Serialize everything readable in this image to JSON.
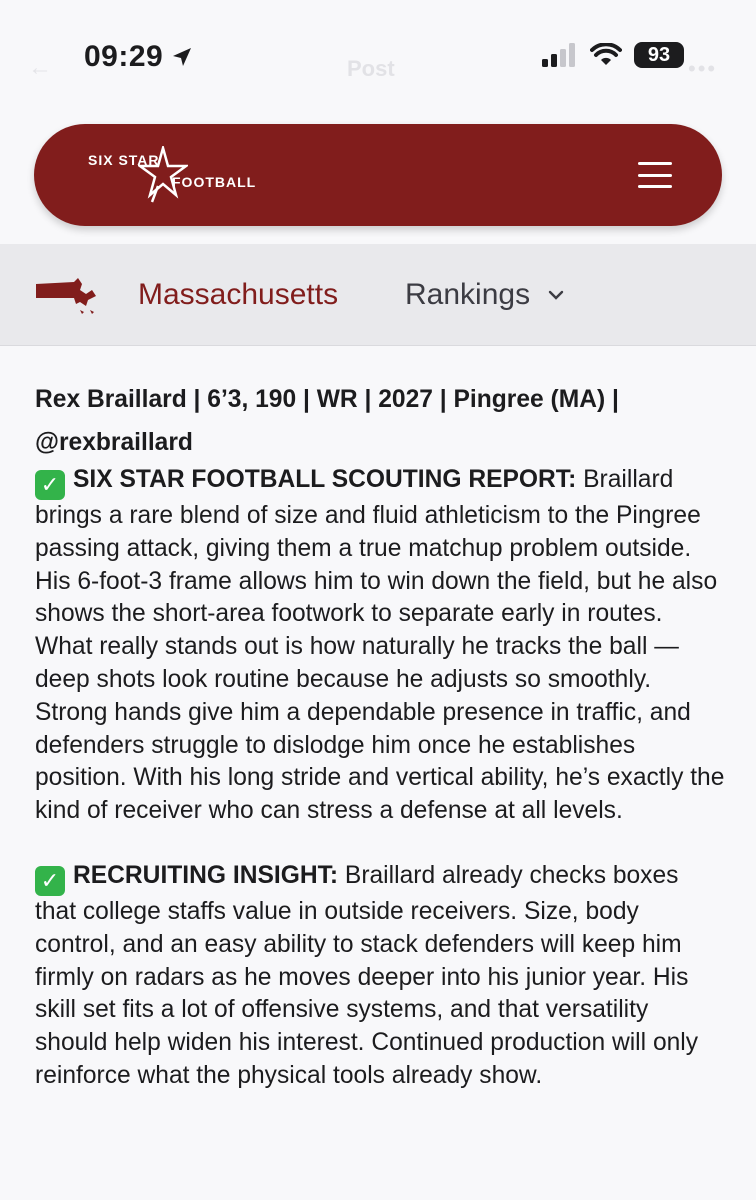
{
  "status_bar": {
    "time": "09:29",
    "battery": "93",
    "ghost_back": "←",
    "ghost_title": "Post",
    "ghost_more": "•••"
  },
  "header": {
    "logo_line1": "SIX STAR",
    "logo_line2": "FOOTBALL",
    "brand_color": "#811d1c"
  },
  "subnav": {
    "state": "Massachusetts",
    "rankings": "Rankings"
  },
  "article": {
    "headline_line1": "Rex Braillard | 6’3, 190 | WR | 2027 | Pingree (MA) |",
    "headline_line2": "@rexbraillard",
    "scouting": {
      "label": "SIX STAR FOOTBALL SCOUTING REPORT:",
      "text": " Braillard brings a rare blend of size and fluid athleticism to the Pingree passing attack, giving them a true matchup problem outside. His 6-foot-3 frame allows him to win down the field, but he also shows the short-area footwork to separate early in routes. What really stands out is how naturally he tracks the ball — deep shots look routine because he adjusts so smoothly. Strong hands give him a dependable presence in traffic, and defenders struggle to dislodge him once he establishes position. With his long stride and vertical ability, he’s exactly the kind of receiver who can stress a defense at all levels."
    },
    "recruiting": {
      "label": "RECRUITING INSIGHT:",
      "text": " Braillard already checks boxes that college staffs value in outside receivers. Size, body control, and an easy ability to stack defenders will keep him firmly on radars as he moves deeper into his junior year. His skill set fits a lot of offensive systems, and that versatility should help widen his interest. Continued production will only reinforce what the physical tools already show."
    }
  }
}
